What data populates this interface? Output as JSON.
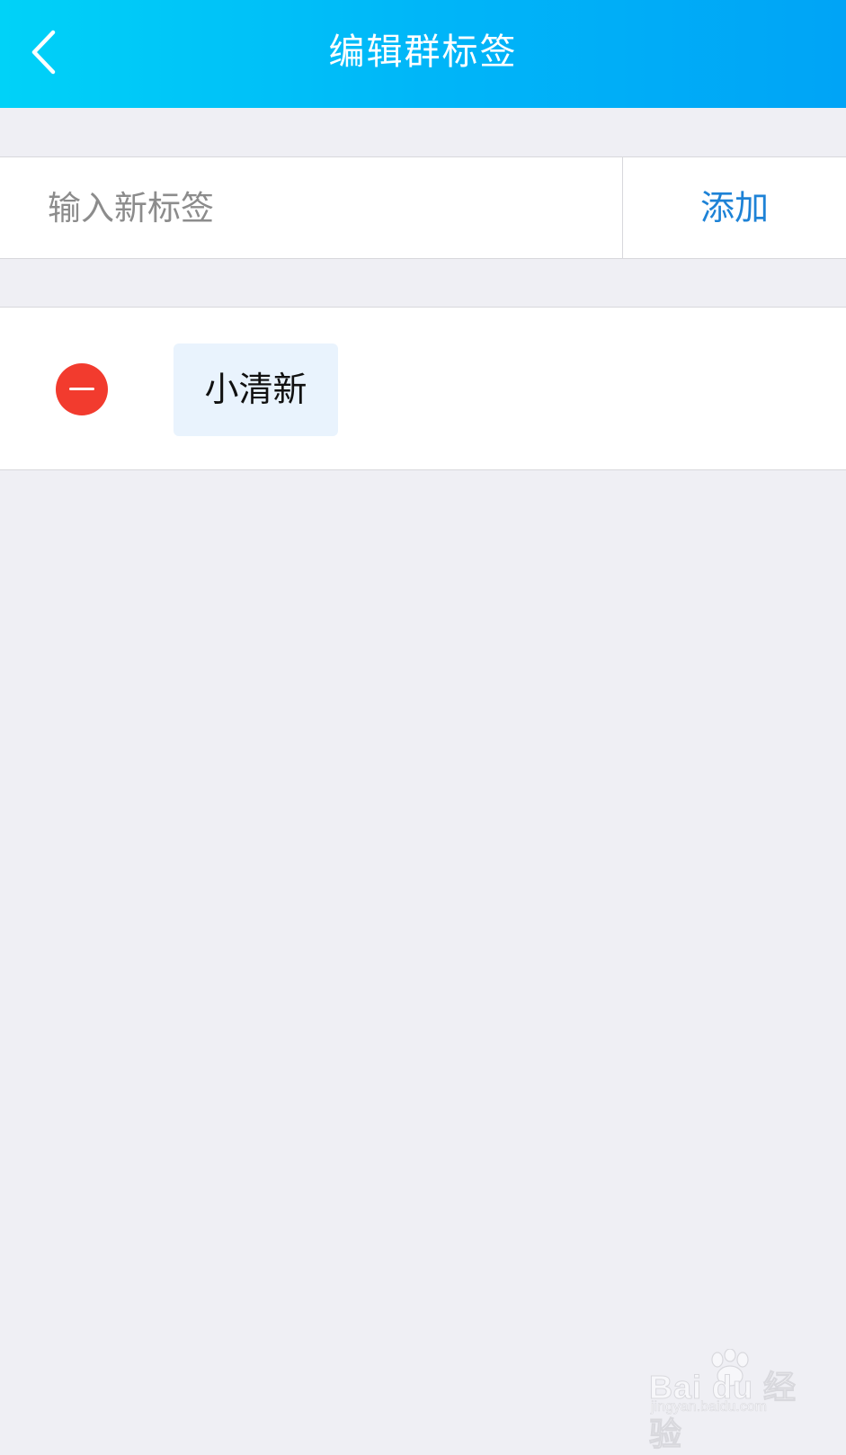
{
  "header": {
    "title": "编辑群标签",
    "back_icon": "chevron-left-icon"
  },
  "tag_input": {
    "placeholder": "输入新标签",
    "value": ""
  },
  "add_button": {
    "label": "添加"
  },
  "tags": [
    {
      "label": "小清新",
      "remove_icon": "minus-circle-icon"
    }
  ],
  "watermark": {
    "brand": "Bai du 经验",
    "url": "jingyan.baidu.com"
  },
  "colors": {
    "header_start": "#00d2f8",
    "header_end": "#00a4f6",
    "accent_blue": "#1d82d6",
    "remove_red": "#f23b2e",
    "chip_bg": "#e9f3fd",
    "page_bg": "#efeff4"
  }
}
